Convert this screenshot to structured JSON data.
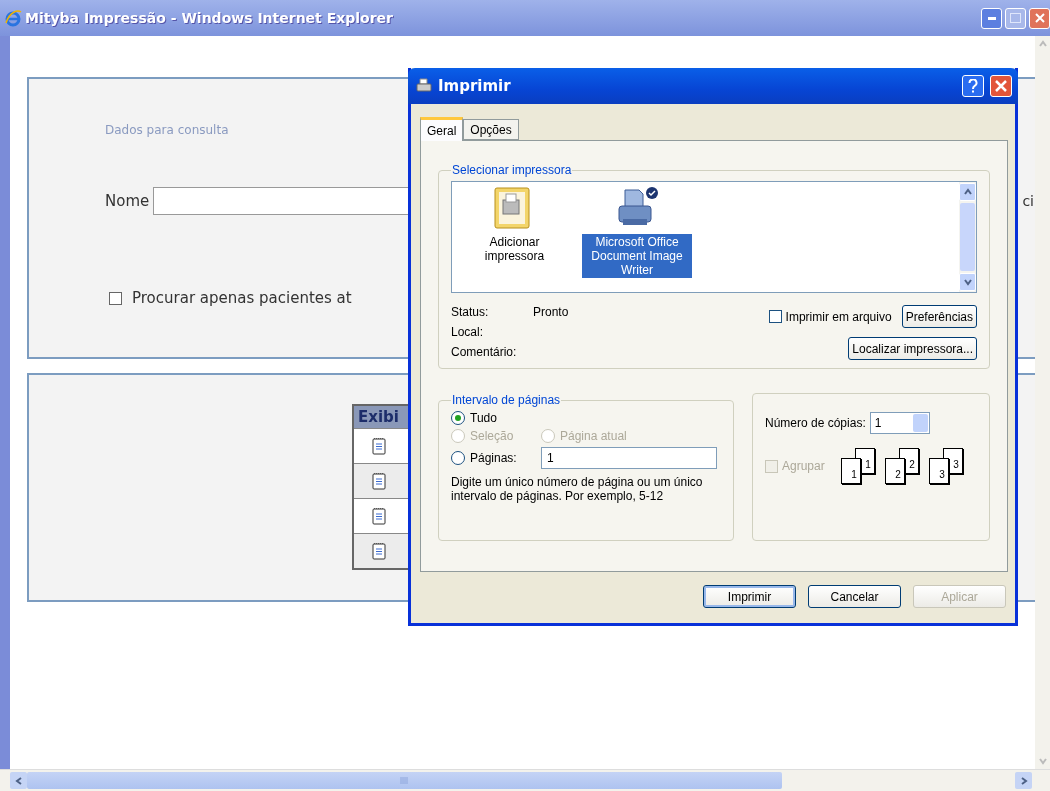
{
  "window": {
    "title": "Mityba Impressão - Windows Internet Explorer"
  },
  "search_panel": {
    "heading": "Dados para consulta",
    "name_label": "Nome",
    "active_only": {
      "label": "Procurar apenas pacientes at",
      "checked": false
    },
    "cut_label": "ci"
  },
  "results_table": {
    "header": "Exibi",
    "rows": [
      {
        "kind": "document"
      },
      {
        "kind": "document"
      },
      {
        "kind": "document"
      },
      {
        "kind": "document"
      }
    ]
  },
  "dialog": {
    "title": "Imprimir",
    "tabs": [
      {
        "label": "Geral",
        "selected": true
      },
      {
        "label": "Opções",
        "selected": false
      }
    ],
    "printer_group": {
      "legend": "Selecionar impressora",
      "printers": [
        {
          "kind": "add",
          "label": "Adicionar impressora",
          "selected": false,
          "default": false
        },
        {
          "kind": "printer",
          "label": "Microsoft Office Document Image Writer",
          "selected": true,
          "default": true
        }
      ]
    },
    "status": [
      {
        "label": "Status:",
        "value": "Pronto"
      },
      {
        "label": "Local:"
      },
      {
        "label": "Comentário:"
      }
    ],
    "print_to_file": {
      "label": "Imprimir em arquivo",
      "checked": false
    },
    "preferences_button": "Preferências",
    "find_printer_button": "Localizar impressora...",
    "page_range": {
      "legend": "Intervalo de páginas",
      "options": [
        {
          "label": "Tudo",
          "selected": true,
          "disabled": false
        },
        {
          "label": "Seleção",
          "selected": false,
          "disabled": true
        },
        {
          "label": "Página atual",
          "selected": false,
          "disabled": true
        },
        {
          "label": "Páginas:",
          "selected": false,
          "disabled": false
        }
      ],
      "pages_value": "1",
      "hint": "Digite um único número de página ou um único intervalo de páginas. Por exemplo, 5-12"
    },
    "copies": {
      "label": "Número de cópias:",
      "value": "1",
      "collate": {
        "label": "Agrupar",
        "checked": false,
        "disabled": true
      },
      "collate_pages": [
        {
          "front": "1",
          "back": "1"
        },
        {
          "front": "2",
          "back": "2"
        },
        {
          "front": "3",
          "back": "3"
        }
      ]
    },
    "buttons": [
      {
        "label": "Imprimir",
        "kind": "default",
        "disabled": false
      },
      {
        "label": "Cancelar",
        "kind": "normal",
        "disabled": false
      },
      {
        "label": "Aplicar",
        "kind": "normal",
        "disabled": true
      }
    ]
  }
}
